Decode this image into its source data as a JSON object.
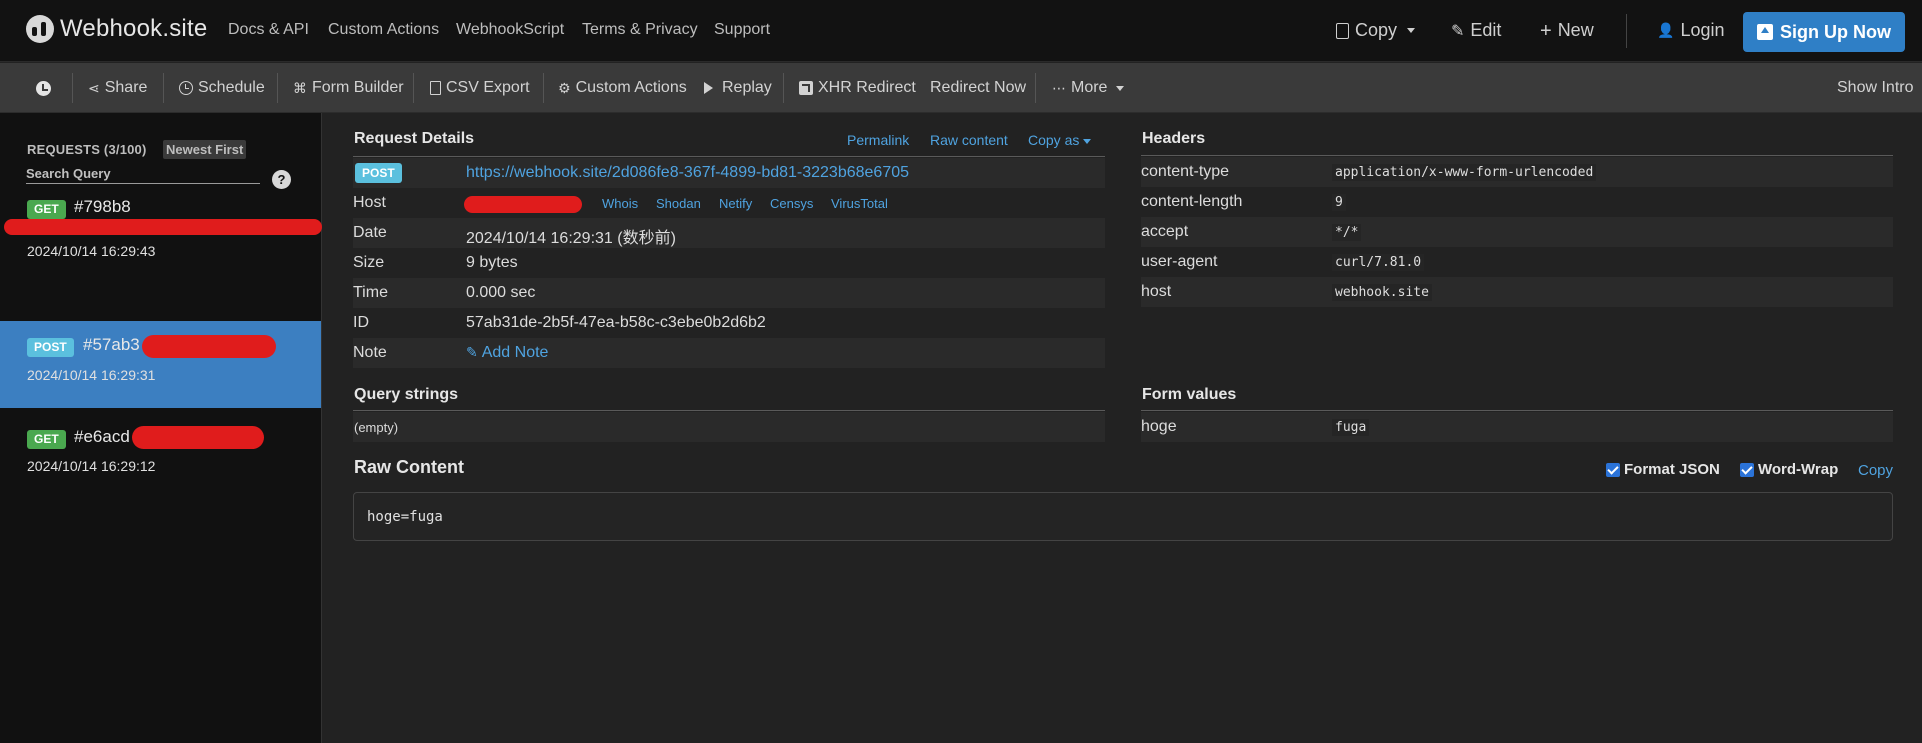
{
  "topnav": {
    "brand": "Webhook.site",
    "links": [
      "Docs & API",
      "Custom Actions",
      "WebhookScript",
      "Terms & Privacy",
      "Support"
    ],
    "copy": "Copy",
    "edit": "Edit",
    "new": "New",
    "login": "Login",
    "signup": "Sign Up Now"
  },
  "toolbar": {
    "share": "Share",
    "schedule": "Schedule",
    "form_builder": "Form Builder",
    "csv_export": "CSV Export",
    "custom_actions": "Custom Actions",
    "replay": "Replay",
    "xhr_redirect": "XHR Redirect",
    "redirect_now": "Redirect Now",
    "more": "More",
    "show_intro": "Show Intro"
  },
  "sidebar": {
    "requests_header": "REQUESTS (3/100)",
    "sort_button": "Newest First",
    "search_placeholder": "Search Query",
    "help": "?",
    "items": [
      {
        "method": "GET",
        "id": "#798b8",
        "time": "2024/10/14 16:29:43"
      },
      {
        "method": "POST",
        "id": "#57ab3",
        "time": "2024/10/14 16:29:31"
      },
      {
        "method": "GET",
        "id": "#e6acd",
        "time": "2024/10/14 16:29:12"
      }
    ]
  },
  "details": {
    "title": "Request Details",
    "permalink": "Permalink",
    "raw_content": "Raw content",
    "copy_as": "Copy as",
    "method": "POST",
    "url": "https://webhook.site/2d086fe8-367f-4899-bd81-3223b68e6705",
    "rows": {
      "host_label": "Host",
      "date_label": "Date",
      "date_value": "2024/10/14 16:29:31 (数秒前)",
      "size_label": "Size",
      "size_value": "9 bytes",
      "time_label": "Time",
      "time_value": "0.000 sec",
      "id_label": "ID",
      "id_value": "57ab31de-2b5f-47ea-b58c-c3ebe0b2d6b2",
      "note_label": "Note",
      "add_note": "Add Note"
    },
    "host_links": [
      "Whois",
      "Shodan",
      "Netify",
      "Censys",
      "VirusTotal"
    ]
  },
  "headers": {
    "title": "Headers",
    "items": [
      {
        "name": "content-type",
        "value": "application/x-www-form-urlencoded"
      },
      {
        "name": "content-length",
        "value": "9"
      },
      {
        "name": "accept",
        "value": "*/*"
      },
      {
        "name": "user-agent",
        "value": "curl/7.81.0"
      },
      {
        "name": "host",
        "value": "webhook.site"
      }
    ]
  },
  "query_strings": {
    "title": "Query strings",
    "empty": "(empty)"
  },
  "form_values": {
    "title": "Form values",
    "items": [
      {
        "name": "hoge",
        "value": "fuga"
      }
    ]
  },
  "raw": {
    "title": "Raw Content",
    "format_json": "Format JSON",
    "word_wrap": "Word-Wrap",
    "copy": "Copy",
    "content": "hoge=fuga"
  },
  "colors": {
    "accent": "#2f7fc6",
    "active_item": "#3c7fc1",
    "get": "#4aa84f",
    "post": "#5bc0de",
    "redaction": "#e01c1c"
  }
}
